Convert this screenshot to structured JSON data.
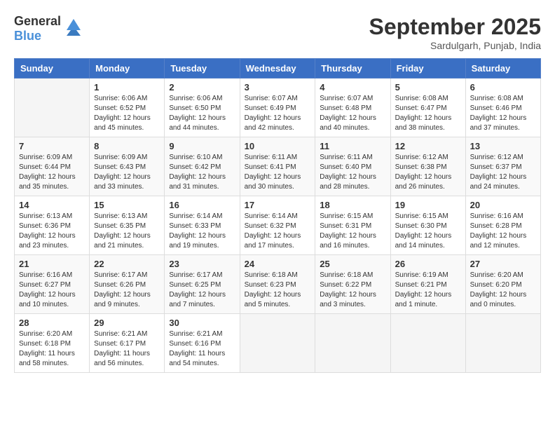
{
  "logo": {
    "general": "General",
    "blue": "Blue"
  },
  "header": {
    "month": "September 2025",
    "location": "Sardulgarh, Punjab, India"
  },
  "weekdays": [
    "Sunday",
    "Monday",
    "Tuesday",
    "Wednesday",
    "Thursday",
    "Friday",
    "Saturday"
  ],
  "weeks": [
    [
      {
        "day": "",
        "sunrise": "",
        "sunset": "",
        "daylight": ""
      },
      {
        "day": "1",
        "sunrise": "Sunrise: 6:06 AM",
        "sunset": "Sunset: 6:52 PM",
        "daylight": "Daylight: 12 hours and 45 minutes."
      },
      {
        "day": "2",
        "sunrise": "Sunrise: 6:06 AM",
        "sunset": "Sunset: 6:50 PM",
        "daylight": "Daylight: 12 hours and 44 minutes."
      },
      {
        "day": "3",
        "sunrise": "Sunrise: 6:07 AM",
        "sunset": "Sunset: 6:49 PM",
        "daylight": "Daylight: 12 hours and 42 minutes."
      },
      {
        "day": "4",
        "sunrise": "Sunrise: 6:07 AM",
        "sunset": "Sunset: 6:48 PM",
        "daylight": "Daylight: 12 hours and 40 minutes."
      },
      {
        "day": "5",
        "sunrise": "Sunrise: 6:08 AM",
        "sunset": "Sunset: 6:47 PM",
        "daylight": "Daylight: 12 hours and 38 minutes."
      },
      {
        "day": "6",
        "sunrise": "Sunrise: 6:08 AM",
        "sunset": "Sunset: 6:46 PM",
        "daylight": "Daylight: 12 hours and 37 minutes."
      }
    ],
    [
      {
        "day": "7",
        "sunrise": "Sunrise: 6:09 AM",
        "sunset": "Sunset: 6:44 PM",
        "daylight": "Daylight: 12 hours and 35 minutes."
      },
      {
        "day": "8",
        "sunrise": "Sunrise: 6:09 AM",
        "sunset": "Sunset: 6:43 PM",
        "daylight": "Daylight: 12 hours and 33 minutes."
      },
      {
        "day": "9",
        "sunrise": "Sunrise: 6:10 AM",
        "sunset": "Sunset: 6:42 PM",
        "daylight": "Daylight: 12 hours and 31 minutes."
      },
      {
        "day": "10",
        "sunrise": "Sunrise: 6:11 AM",
        "sunset": "Sunset: 6:41 PM",
        "daylight": "Daylight: 12 hours and 30 minutes."
      },
      {
        "day": "11",
        "sunrise": "Sunrise: 6:11 AM",
        "sunset": "Sunset: 6:40 PM",
        "daylight": "Daylight: 12 hours and 28 minutes."
      },
      {
        "day": "12",
        "sunrise": "Sunrise: 6:12 AM",
        "sunset": "Sunset: 6:38 PM",
        "daylight": "Daylight: 12 hours and 26 minutes."
      },
      {
        "day": "13",
        "sunrise": "Sunrise: 6:12 AM",
        "sunset": "Sunset: 6:37 PM",
        "daylight": "Daylight: 12 hours and 24 minutes."
      }
    ],
    [
      {
        "day": "14",
        "sunrise": "Sunrise: 6:13 AM",
        "sunset": "Sunset: 6:36 PM",
        "daylight": "Daylight: 12 hours and 23 minutes."
      },
      {
        "day": "15",
        "sunrise": "Sunrise: 6:13 AM",
        "sunset": "Sunset: 6:35 PM",
        "daylight": "Daylight: 12 hours and 21 minutes."
      },
      {
        "day": "16",
        "sunrise": "Sunrise: 6:14 AM",
        "sunset": "Sunset: 6:33 PM",
        "daylight": "Daylight: 12 hours and 19 minutes."
      },
      {
        "day": "17",
        "sunrise": "Sunrise: 6:14 AM",
        "sunset": "Sunset: 6:32 PM",
        "daylight": "Daylight: 12 hours and 17 minutes."
      },
      {
        "day": "18",
        "sunrise": "Sunrise: 6:15 AM",
        "sunset": "Sunset: 6:31 PM",
        "daylight": "Daylight: 12 hours and 16 minutes."
      },
      {
        "day": "19",
        "sunrise": "Sunrise: 6:15 AM",
        "sunset": "Sunset: 6:30 PM",
        "daylight": "Daylight: 12 hours and 14 minutes."
      },
      {
        "day": "20",
        "sunrise": "Sunrise: 6:16 AM",
        "sunset": "Sunset: 6:28 PM",
        "daylight": "Daylight: 12 hours and 12 minutes."
      }
    ],
    [
      {
        "day": "21",
        "sunrise": "Sunrise: 6:16 AM",
        "sunset": "Sunset: 6:27 PM",
        "daylight": "Daylight: 12 hours and 10 minutes."
      },
      {
        "day": "22",
        "sunrise": "Sunrise: 6:17 AM",
        "sunset": "Sunset: 6:26 PM",
        "daylight": "Daylight: 12 hours and 9 minutes."
      },
      {
        "day": "23",
        "sunrise": "Sunrise: 6:17 AM",
        "sunset": "Sunset: 6:25 PM",
        "daylight": "Daylight: 12 hours and 7 minutes."
      },
      {
        "day": "24",
        "sunrise": "Sunrise: 6:18 AM",
        "sunset": "Sunset: 6:23 PM",
        "daylight": "Daylight: 12 hours and 5 minutes."
      },
      {
        "day": "25",
        "sunrise": "Sunrise: 6:18 AM",
        "sunset": "Sunset: 6:22 PM",
        "daylight": "Daylight: 12 hours and 3 minutes."
      },
      {
        "day": "26",
        "sunrise": "Sunrise: 6:19 AM",
        "sunset": "Sunset: 6:21 PM",
        "daylight": "Daylight: 12 hours and 1 minute."
      },
      {
        "day": "27",
        "sunrise": "Sunrise: 6:20 AM",
        "sunset": "Sunset: 6:20 PM",
        "daylight": "Daylight: 12 hours and 0 minutes."
      }
    ],
    [
      {
        "day": "28",
        "sunrise": "Sunrise: 6:20 AM",
        "sunset": "Sunset: 6:18 PM",
        "daylight": "Daylight: 11 hours and 58 minutes."
      },
      {
        "day": "29",
        "sunrise": "Sunrise: 6:21 AM",
        "sunset": "Sunset: 6:17 PM",
        "daylight": "Daylight: 11 hours and 56 minutes."
      },
      {
        "day": "30",
        "sunrise": "Sunrise: 6:21 AM",
        "sunset": "Sunset: 6:16 PM",
        "daylight": "Daylight: 11 hours and 54 minutes."
      },
      {
        "day": "",
        "sunrise": "",
        "sunset": "",
        "daylight": ""
      },
      {
        "day": "",
        "sunrise": "",
        "sunset": "",
        "daylight": ""
      },
      {
        "day": "",
        "sunrise": "",
        "sunset": "",
        "daylight": ""
      },
      {
        "day": "",
        "sunrise": "",
        "sunset": "",
        "daylight": ""
      }
    ]
  ]
}
